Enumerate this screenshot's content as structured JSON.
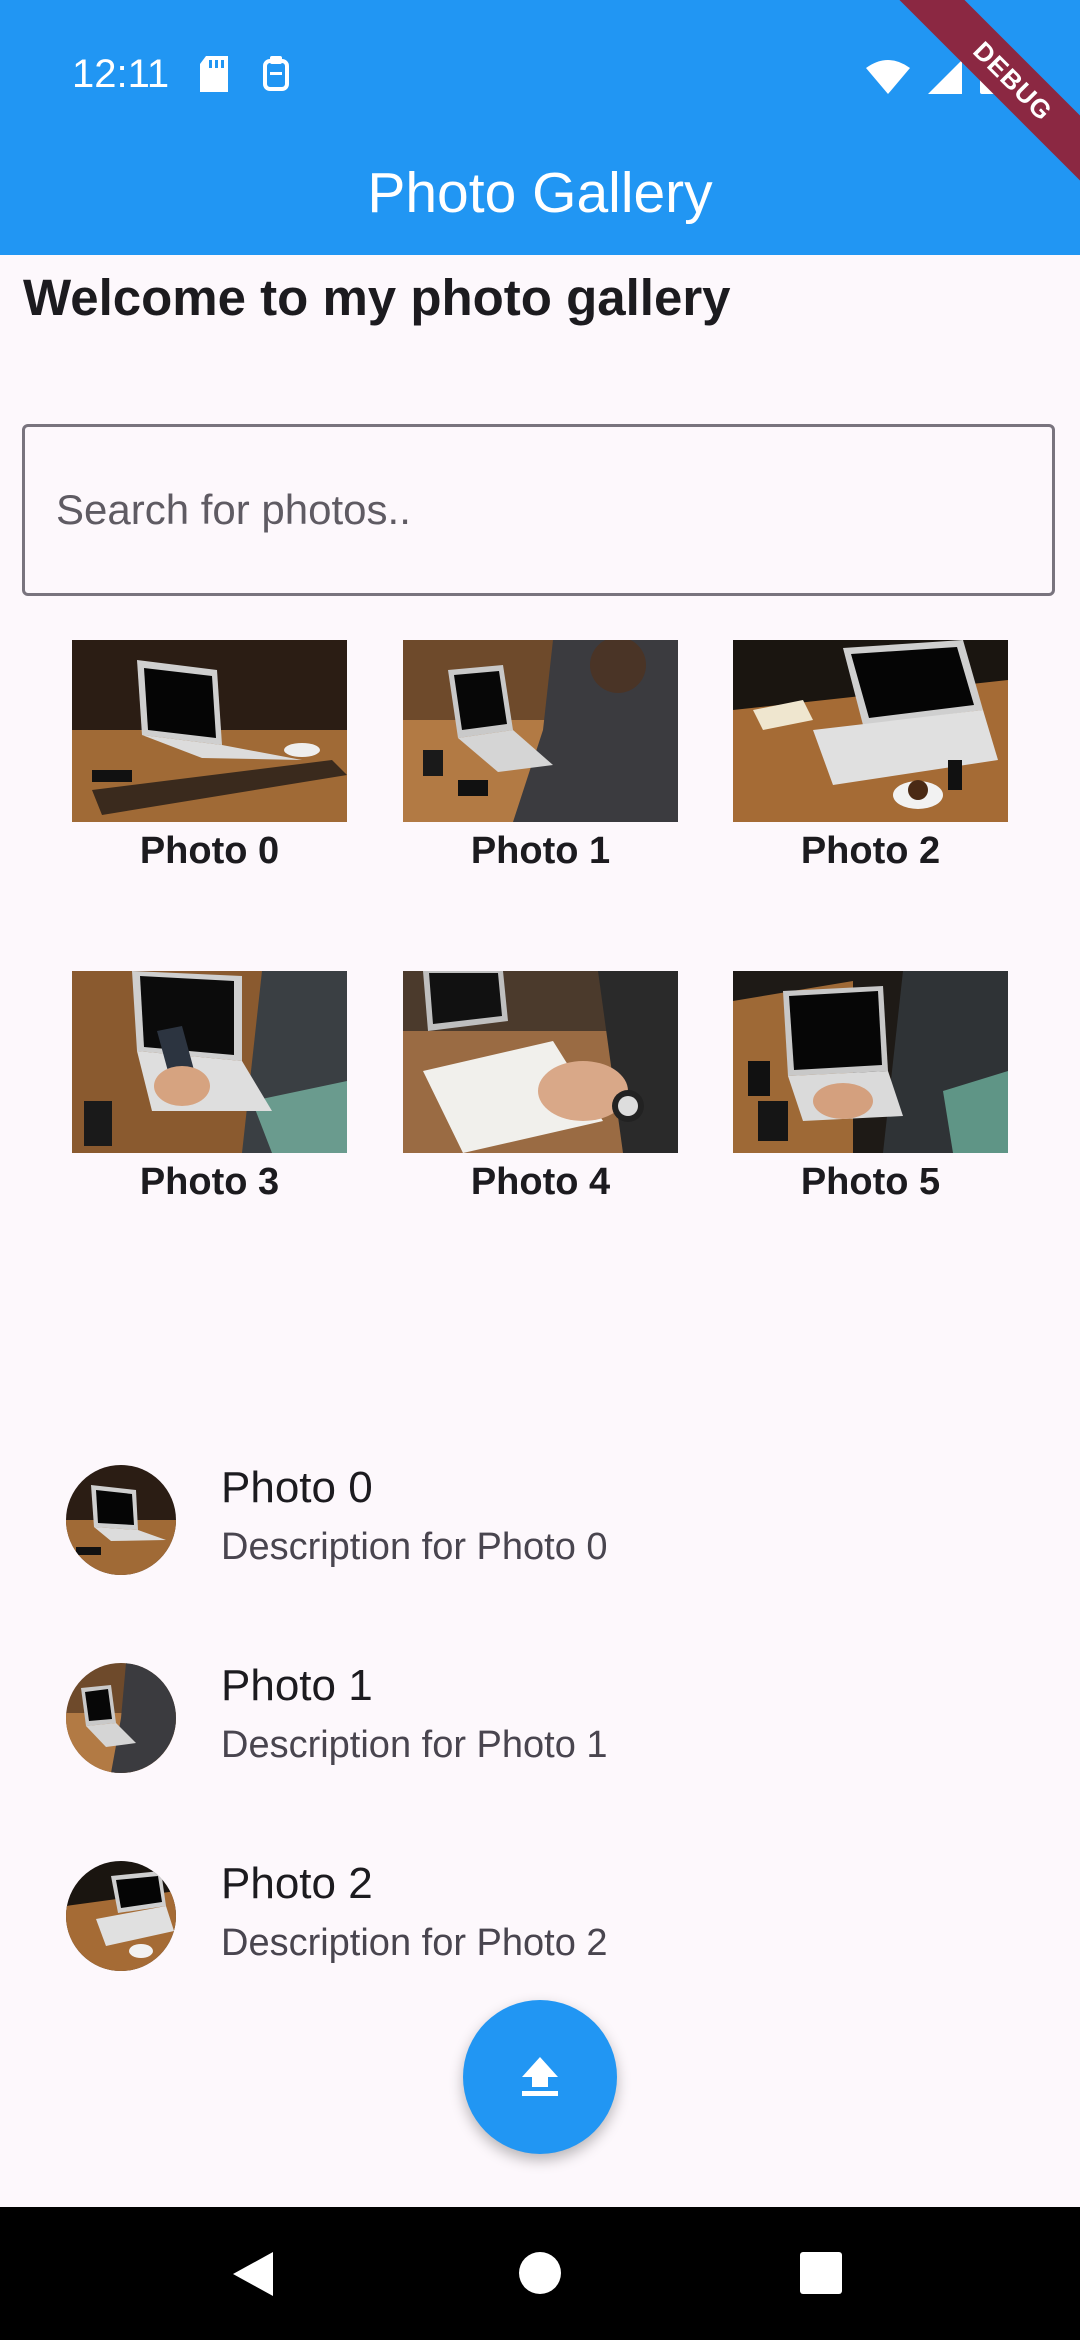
{
  "status_bar": {
    "time": "12:11",
    "icons_left": [
      "sd-card-icon",
      "clipboard-icon"
    ],
    "icons_right": [
      "wifi-icon",
      "signal-icon",
      "battery-icon"
    ]
  },
  "app_bar": {
    "title": "Photo Gallery",
    "debug_label": "DEBUG",
    "color": "#2196f3"
  },
  "main": {
    "heading": "Welcome to my photo gallery",
    "search": {
      "placeholder": "Search for photos..",
      "value": ""
    },
    "grid": [
      {
        "caption": "Photo 0"
      },
      {
        "caption": "Photo 1"
      },
      {
        "caption": "Photo 2"
      },
      {
        "caption": "Photo 3"
      },
      {
        "caption": "Photo 4"
      },
      {
        "caption": "Photo 5"
      }
    ],
    "list": [
      {
        "title": "Photo 0",
        "subtitle": "Description for Photo 0"
      },
      {
        "title": "Photo 1",
        "subtitle": "Description for Photo 1"
      },
      {
        "title": "Photo 2",
        "subtitle": "Description for Photo 2"
      }
    ]
  },
  "fab": {
    "icon": "upload-icon"
  },
  "nav_bar": {
    "icons": [
      "back-icon",
      "home-icon",
      "recents-icon"
    ]
  }
}
